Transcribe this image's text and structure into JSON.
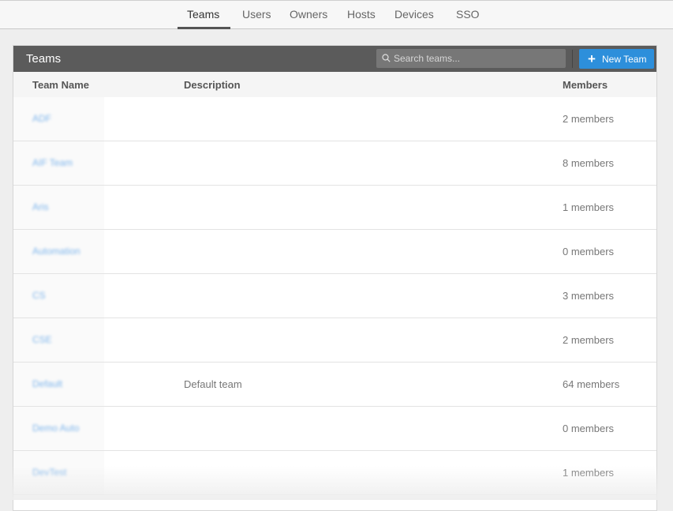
{
  "nav": {
    "tabs": [
      {
        "label": "Teams",
        "active": true
      },
      {
        "label": "Users",
        "active": false
      },
      {
        "label": "Owners",
        "active": false
      },
      {
        "label": "Hosts",
        "active": false
      },
      {
        "label": "Devices",
        "active": false
      },
      {
        "label": "SSO",
        "active": false
      }
    ]
  },
  "panel": {
    "title": "Teams",
    "search": {
      "placeholder": "Search teams...",
      "value": "",
      "icon": "search-icon"
    },
    "new_team_button": {
      "label": "New Team",
      "icon": "plus-icon"
    }
  },
  "table": {
    "columns": [
      "Team Name",
      "Description",
      "Members"
    ],
    "rows": [
      {
        "name": "ADF",
        "description": "",
        "members": "2 members"
      },
      {
        "name": "AIF Team",
        "description": "",
        "members": "8 members"
      },
      {
        "name": "Aris",
        "description": "",
        "members": "1 members"
      },
      {
        "name": "Automation",
        "description": "",
        "members": "0 members"
      },
      {
        "name": "CS",
        "description": "",
        "members": "3 members"
      },
      {
        "name": "CSE",
        "description": "",
        "members": "2 members"
      },
      {
        "name": "Default",
        "description": "Default team",
        "members": "64 members"
      },
      {
        "name": "Demo Auto",
        "description": "",
        "members": "0 members"
      },
      {
        "name": "DevTest",
        "description": "",
        "members": "1 members"
      }
    ]
  },
  "colors": {
    "header_bg": "#5b5b5b",
    "accent": "#2d8fdb",
    "link": "#7fb6ec"
  }
}
